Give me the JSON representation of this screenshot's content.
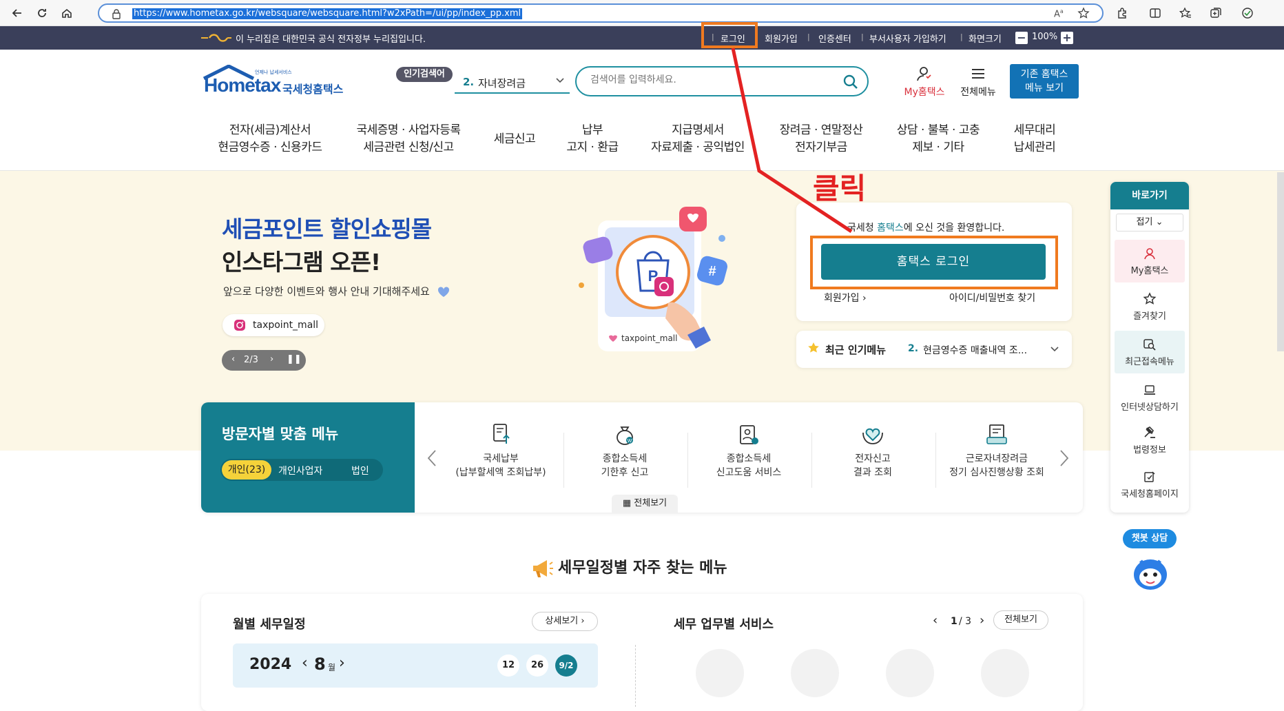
{
  "browser": {
    "url": "https://www.hometax.go.kr/websquare/websquare.html?w2xPath=/ui/pp/index_pp.xml"
  },
  "gov_strip": {
    "notice": "이 누리집은 대한민국 공식 전자정부 누리집입니다.",
    "links": [
      "로그인",
      "회원가입",
      "인증센터",
      "부서사용자 가입하기",
      "화면크기"
    ],
    "zoom": "100%"
  },
  "header": {
    "logo_small": "언제나 납세서비스",
    "logo_text": "Hometax",
    "logo_kor": "국세청홈택스",
    "popular_badge": "인기검색어",
    "popular_rank": "2.",
    "popular_term": "자녀장려금",
    "search_placeholder": "검색어를 입력하세요.",
    "my_hometax": "My홈택스",
    "all_menu": "전체메뉴",
    "legacy_line1": "기존 홈택스",
    "legacy_line2": "메뉴 보기"
  },
  "gnb": [
    {
      "l1": "전자(세금)계산서",
      "l2": "현금영수증 · 신용카드"
    },
    {
      "l1": "국세증명 · 사업자등록",
      "l2": "세금관련 신청/신고"
    },
    {
      "l1": "세금신고",
      "l2": ""
    },
    {
      "l1": "납부",
      "l2": "고지 · 환급"
    },
    {
      "l1": "지급명세서",
      "l2": "자료제출 · 공익법인"
    },
    {
      "l1": "장려금 · 연말정산",
      "l2": "전자기부금"
    },
    {
      "l1": "상담 · 불복 · 고충",
      "l2": "제보 · 기타"
    },
    {
      "l1": "세무대리",
      "l2": "납세관리"
    }
  ],
  "hero": {
    "title1": "세금포인트 할인쇼핑몰",
    "title2": "인스타그램 오픈!",
    "subtitle": "앞으로 다양한 이벤트와 행사 안내 기대해주세요",
    "insta_handle": "taxpoint_mall",
    "slide_indicator": "2/3",
    "illustration_label": "taxpoint_mall"
  },
  "login_card": {
    "welcome_pre": "국세청 ",
    "welcome_brand": "홈택스",
    "welcome_post": "에 오신 것을 환영합니다.",
    "login_button": "홈택스 로그인",
    "signup": "회원가입",
    "find_id": "아이디/비밀번호 찾기"
  },
  "recent_menu": {
    "label": "최근 인기메뉴",
    "rank": "2.",
    "item": "현금영수증 매출내역 조..."
  },
  "quick_bar": {
    "title": "바로가기",
    "fold": "접기",
    "items": [
      "My홈택스",
      "즐겨찾기",
      "최근접속메뉴",
      "인터넷상담하기",
      "법령정보",
      "국세청홈페이지"
    ],
    "chatbot": "챗봇 상담"
  },
  "visitor_menu": {
    "title": "방문자별 맞춤 메뉴",
    "tabs": [
      "개인(23)",
      "개인사업자",
      "법인"
    ],
    "items": [
      {
        "l1": "국세납부",
        "l2": "(납부할세액 조회납부)"
      },
      {
        "l1": "종합소득세",
        "l2": "기한후 신고"
      },
      {
        "l1": "종합소득세",
        "l2": "신고도움 서비스"
      },
      {
        "l1": "전자신고",
        "l2": "결과 조회"
      },
      {
        "l1": "근로자녀장려금",
        "l2": "정기 심사진행상황 조회"
      }
    ],
    "view_all": "전체보기"
  },
  "schedule": {
    "section_title": "세무일정별 자주 찾는 메뉴",
    "monthly_title": "월별 세무일정",
    "detail_btn": "상세보기",
    "year": "2024",
    "month": "8",
    "month_unit": "월",
    "days": [
      "12",
      "26",
      "9/2"
    ],
    "services_title": "세무 업무별 서비스",
    "page_current": "1",
    "page_total": "/ 3",
    "view_all": "전체보기"
  },
  "annotation": {
    "text": "클릭"
  },
  "colors": {
    "teal": "#157e8f",
    "strip": "#3a3f5a",
    "hero_bg": "#fcf7e6",
    "annotation_orange": "#f07a1f",
    "annotation_red": "#e32222"
  }
}
